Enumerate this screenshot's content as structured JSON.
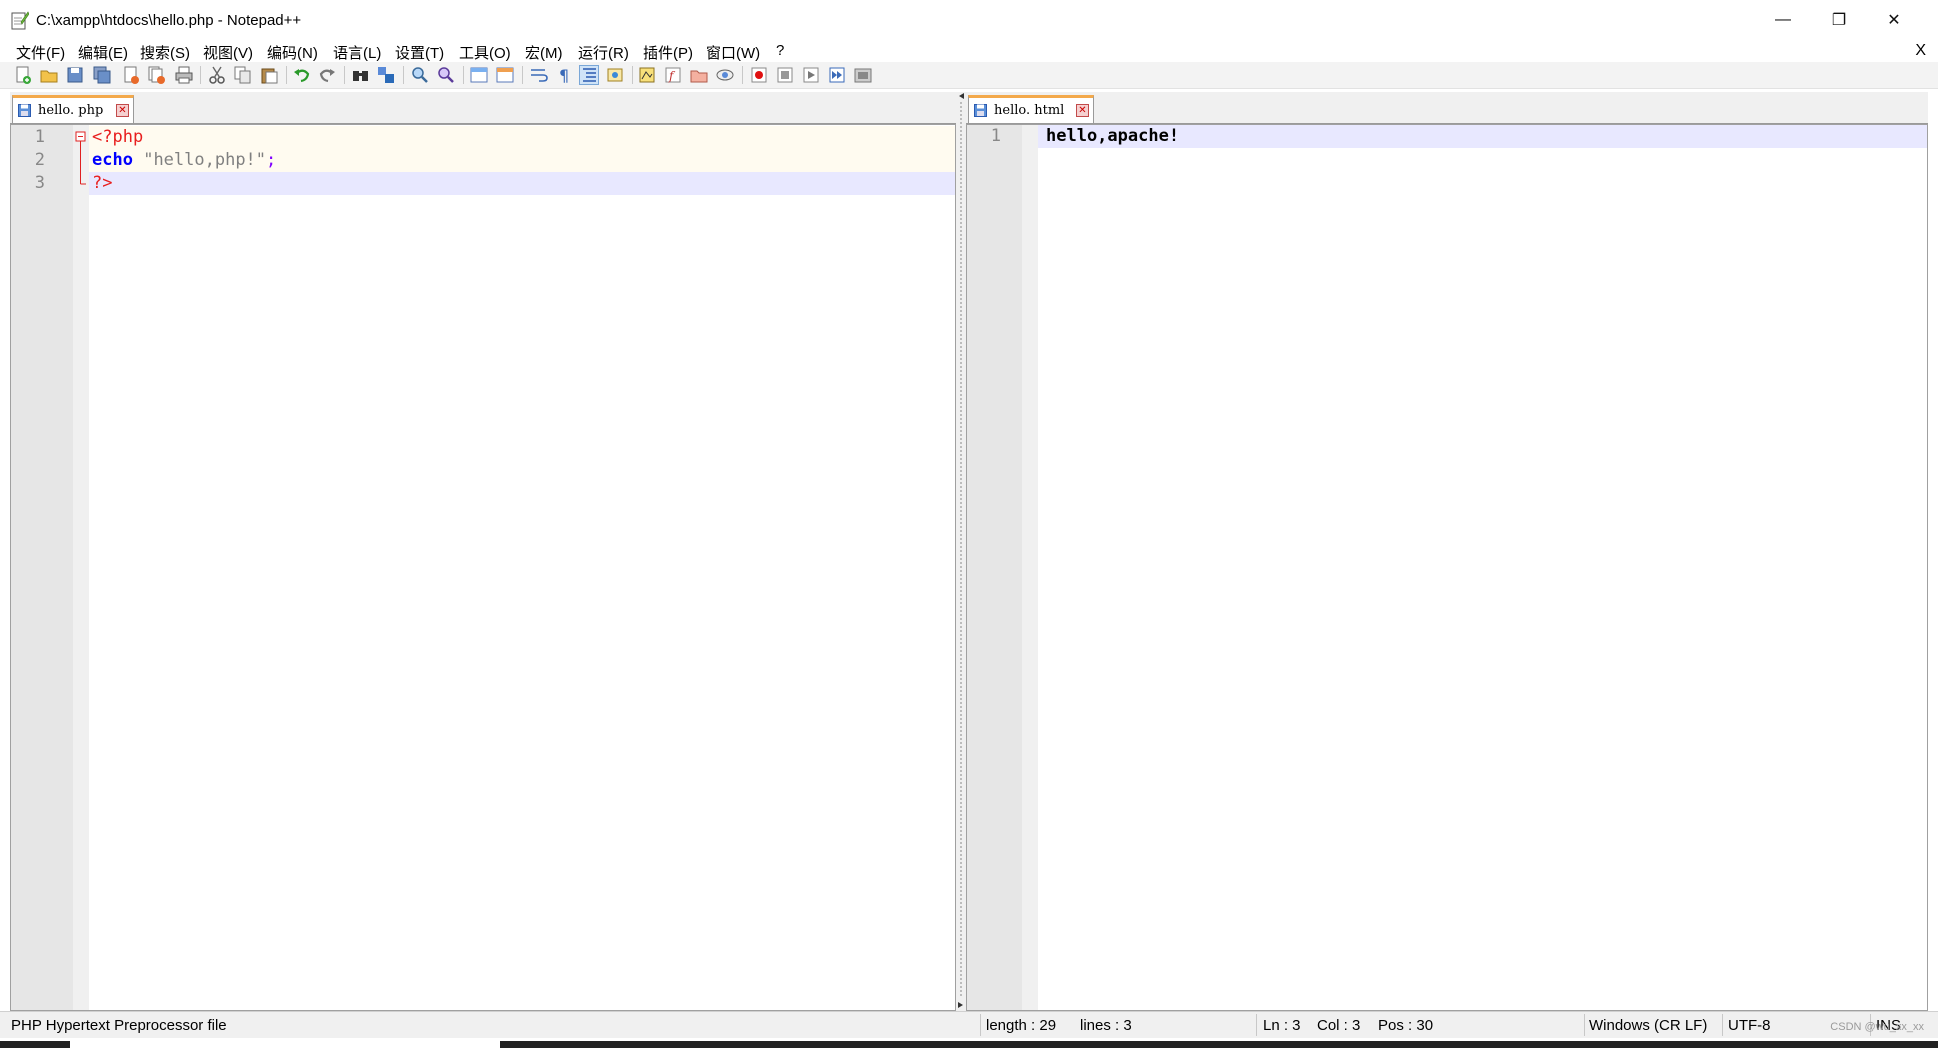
{
  "window": {
    "title": "C:\\xampp\\htdocs\\hello.php - Notepad++",
    "minimize": "—",
    "maximize": "❐",
    "close": "✕",
    "doc_close": "X"
  },
  "menu": [
    "文件(F)",
    "编辑(E)",
    "搜索(S)",
    "视图(V)",
    "编码(N)",
    "语言(L)",
    "设置(T)",
    "工具(O)",
    "宏(M)",
    "运行(R)",
    "插件(P)",
    "窗口(W)",
    "?"
  ],
  "toolbar": {
    "icons": [
      "new-file-icon",
      "open-file-icon",
      "save-icon",
      "save-all-icon",
      "close-icon",
      "close-all-icon",
      "print-icon",
      "cut-icon",
      "copy-icon",
      "paste-icon",
      "undo-icon",
      "redo-icon",
      "find-icon",
      "replace-icon",
      "zoom-in-icon",
      "zoom-out-icon",
      "sync-vertical-icon",
      "sync-horizontal-icon",
      "word-wrap-icon",
      "show-all-chars-icon",
      "indent-guide-icon",
      "user-lang-icon",
      "doc-map-icon",
      "function-list-icon",
      "folder-workspace-icon",
      "monitor-icon",
      "record-macro-icon",
      "stop-record-icon",
      "play-macro-icon",
      "run-macro-multiple-icon",
      "save-macro-icon"
    ]
  },
  "left_pane": {
    "tab_label": "hello. php",
    "lines": [
      {
        "no": "1",
        "tokens": [
          {
            "t": "<?php",
            "c": "#e81e1e"
          }
        ]
      },
      {
        "no": "2",
        "tokens": [
          {
            "t": "echo",
            "c": "#0000ff",
            "b": true
          },
          {
            "t": " ",
            "c": "#000"
          },
          {
            "t": "\"hello,php!\"",
            "c": "#808080"
          },
          {
            "t": ";",
            "c": "#8000ff"
          }
        ]
      },
      {
        "no": "3",
        "tokens": [
          {
            "t": "?>",
            "c": "#e81e1e"
          }
        ]
      }
    ]
  },
  "right_pane": {
    "tab_label": "hello. html",
    "lines": [
      {
        "no": "1",
        "text": "hello,apache!"
      }
    ]
  },
  "statusbar": {
    "file_type": "PHP Hypertext Preprocessor file",
    "length": "length : 29",
    "lines": "lines : 3",
    "ln": "Ln : 3",
    "col": "Col : 3",
    "pos": "Pos : 30",
    "eol": "Windows (CR LF)",
    "encoding": "UTF-8",
    "mode": "INS",
    "watermark": "CSDN @wu_xx_xx"
  },
  "colors": {
    "tab_accent": "#f3a94b",
    "caret_line": "#e8e8ff",
    "php_keyword": "#0000ff",
    "php_tag": "#e81e1e",
    "string": "#808080"
  }
}
